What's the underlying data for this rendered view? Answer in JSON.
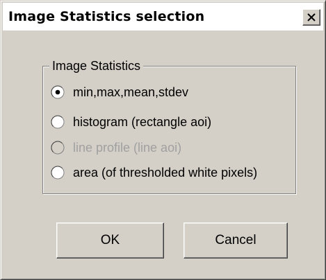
{
  "window": {
    "title": "Image Statistics selection"
  },
  "group": {
    "legend": "Image Statistics",
    "options": [
      {
        "label": "min,max,mean,stdev",
        "selected": true,
        "enabled": true
      },
      {
        "label": "histogram (rectangle aoi)",
        "selected": false,
        "enabled": true
      },
      {
        "label": "line profile (line aoi)",
        "selected": false,
        "enabled": false
      },
      {
        "label": "area (of thresholded white pixels)",
        "selected": false,
        "enabled": true
      }
    ]
  },
  "buttons": {
    "ok_label": "OK",
    "cancel_label": "Cancel"
  },
  "icons": {
    "close": "close-x-icon",
    "radio": "radio-button-icon"
  }
}
